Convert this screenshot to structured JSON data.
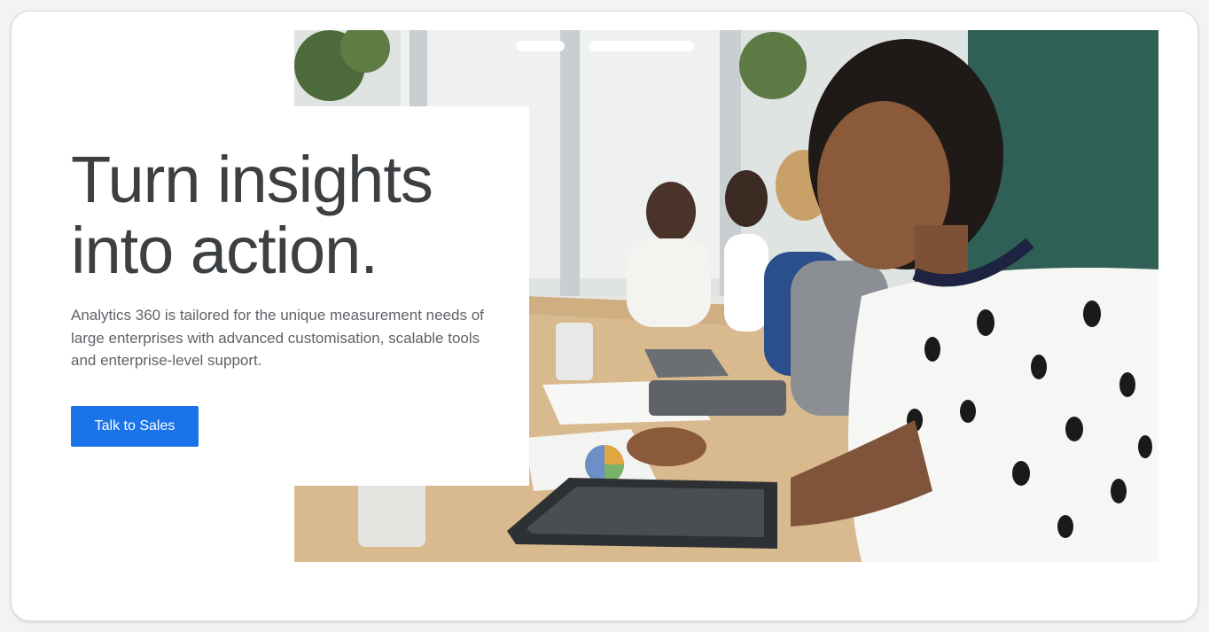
{
  "hero": {
    "headline_line1": "Turn insights",
    "headline_line2": "into action.",
    "description": "Analytics 360 is tailored for the unique measurement needs of large enterprises with advanced customisation, scalable tools and enterprise-level support.",
    "cta_label": "Talk to Sales"
  },
  "colors": {
    "accent": "#1a73e8",
    "headline": "#3c4043",
    "body": "#5f6368"
  },
  "icons": {
    "photo": "team-meeting-photo"
  }
}
